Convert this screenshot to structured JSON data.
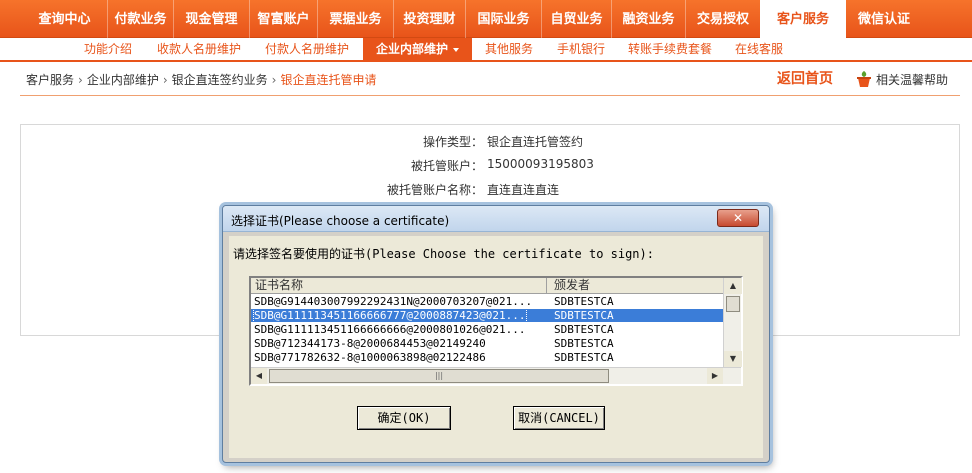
{
  "topnav": {
    "tabs": [
      "查询中心",
      "付款业务",
      "现金管理",
      "智富账户",
      "票据业务",
      "投资理财",
      "国际业务",
      "自贸业务",
      "融资业务",
      "交易授权",
      "客户服务",
      "微信认证"
    ],
    "active": "客户服务"
  },
  "subnav": {
    "items": [
      "功能介绍",
      "收款人名册维护",
      "付款人名册维护",
      "企业内部维护",
      "其他服务",
      "手机银行",
      "转账手续费套餐",
      "在线客服"
    ],
    "active": "企业内部维护"
  },
  "breadcrumb": {
    "items": [
      "客户服务",
      "企业内部维护",
      "银企直连签约业务"
    ],
    "current": "银企直连托管申请",
    "sep": "›"
  },
  "header_links": {
    "home": "返回首页",
    "help": "相关温馨帮助"
  },
  "form": {
    "rows": [
      {
        "label": "操作类型：",
        "value": "银企直连托管签约"
      },
      {
        "label": "被托管账户：",
        "value": "15000093195803"
      },
      {
        "label": "被托管账户名称：",
        "value": "直连直连直连"
      }
    ]
  },
  "dialog": {
    "title": "选择证书(Please choose a certificate)",
    "close": "✕",
    "prompt": "请选择签名要使用的证书(Please Choose  the certificate to sign):",
    "columns": [
      "证书名称",
      "颁发者"
    ],
    "rows": [
      {
        "name": "SDB@G914403007992292431N@2000703207@021...",
        "issuer": "SDBTESTCA"
      },
      {
        "name": "SDB@G111113451166666777@2000887423@021...",
        "issuer": "SDBTESTCA"
      },
      {
        "name": "SDB@G111113451166666666@2000801026@021...",
        "issuer": "SDBTESTCA"
      },
      {
        "name": "SDB@712344173-8@2000684453@02149240",
        "issuer": "SDBTESTCA"
      },
      {
        "name": "SDB@771782632-8@1000063898@02122486",
        "issuer": "SDBTESTCA"
      }
    ],
    "selected_index": 1,
    "ok": "确定(OK)",
    "cancel": "取消(CANCEL)"
  }
}
